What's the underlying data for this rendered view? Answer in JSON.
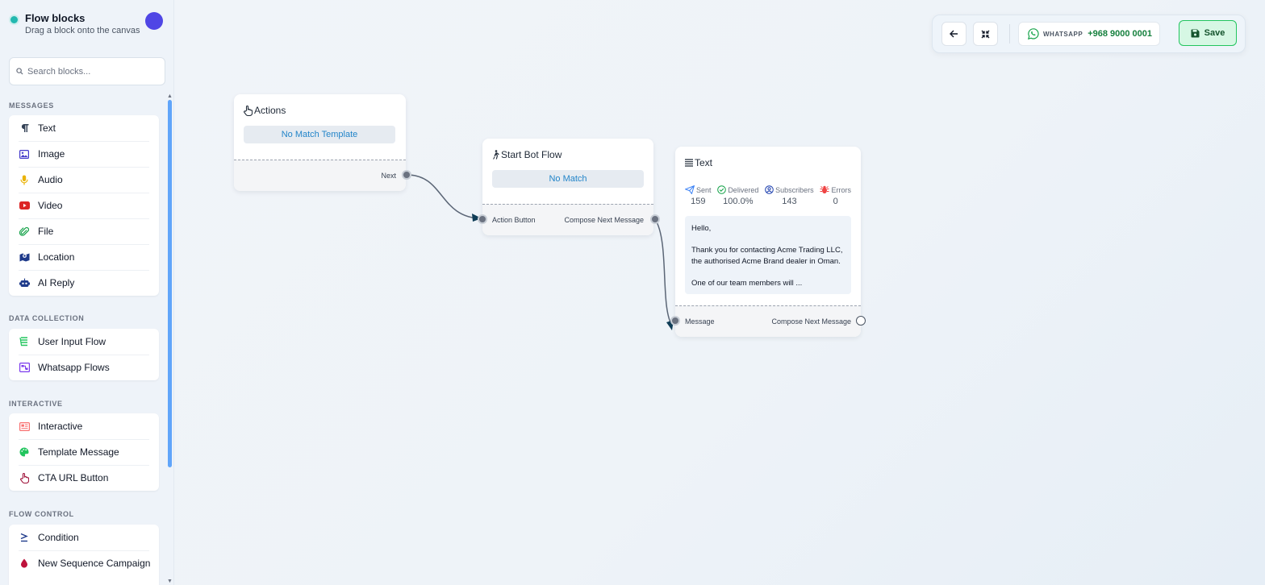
{
  "sidebar": {
    "title": "Flow blocks",
    "subtitle": "Drag a block onto the canvas",
    "search_placeholder": "Search blocks...",
    "categories": [
      {
        "label": "MESSAGES",
        "items": [
          {
            "label": "Text",
            "icon": "paragraph-icon"
          },
          {
            "label": "Image",
            "icon": "image-icon"
          },
          {
            "label": "Audio",
            "icon": "microphone-icon"
          },
          {
            "label": "Video",
            "icon": "youtube-icon"
          },
          {
            "label": "File",
            "icon": "paperclip-icon"
          },
          {
            "label": "Location",
            "icon": "map-location-icon"
          },
          {
            "label": "AI Reply",
            "icon": "robot-icon"
          }
        ]
      },
      {
        "label": "DATA COLLECTION",
        "items": [
          {
            "label": "User Input Flow",
            "icon": "layers-icon"
          },
          {
            "label": "Whatsapp Flows",
            "icon": "flow-chart-icon"
          }
        ]
      },
      {
        "label": "INTERACTIVE",
        "items": [
          {
            "label": "Interactive",
            "icon": "newspaper-icon"
          },
          {
            "label": "Template Message",
            "icon": "palette-icon"
          },
          {
            "label": "CTA URL Button",
            "icon": "pointer-hand-icon"
          }
        ]
      },
      {
        "label": "FLOW CONTROL",
        "items": [
          {
            "label": "Condition",
            "icon": "greater-equal-icon"
          },
          {
            "label": "New Sequence Campaign",
            "icon": "droplet-icon"
          }
        ]
      }
    ]
  },
  "toolbar": {
    "whatsapp_label": "WHATSAPP",
    "whatsapp_number": "+968 9000 0001",
    "save_label": "Save"
  },
  "nodes": {
    "actions": {
      "title": "Actions",
      "pill": "No Match Template",
      "out_label": "Next"
    },
    "start": {
      "title": "Start Bot Flow",
      "pill": "No Match",
      "in_label": "Action Button",
      "out_label": "Compose Next Message"
    },
    "text": {
      "title": "Text",
      "stats": [
        {
          "label": "Sent",
          "value": "159"
        },
        {
          "label": "Delivered",
          "value": "100.0%"
        },
        {
          "label": "Subscribers",
          "value": "143"
        },
        {
          "label": "Errors",
          "value": "0"
        }
      ],
      "preview": {
        "line1": "Hello,",
        "line2": "Thank you for contacting Acme Trading LLC, the authorised Acme Brand dealer in Oman.",
        "line3": "One of our team members will ..."
      },
      "in_label": "Message",
      "out_label": "Compose Next Message"
    }
  },
  "colors": {
    "accent": "#2385c9",
    "save_bg": "#d6f7e4",
    "save_border": "#22c55e",
    "avatar": "#4f46e5",
    "scrollbar": "#60a5fa",
    "whatsapp": "#15803d"
  }
}
